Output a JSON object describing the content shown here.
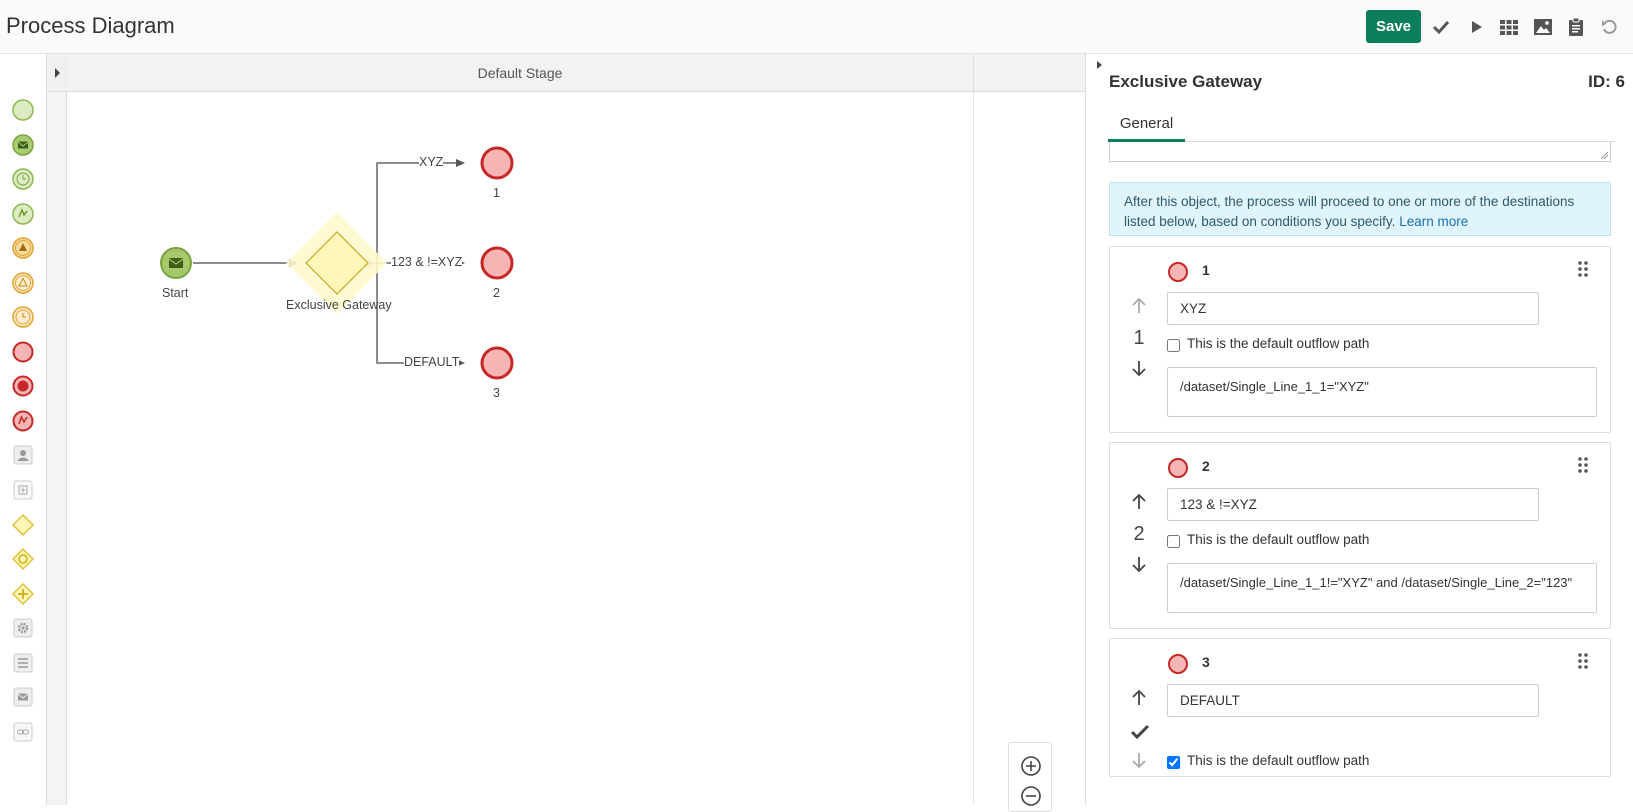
{
  "header": {
    "title": "Process Diagram",
    "save_label": "Save",
    "tools": [
      "check-icon",
      "play-icon",
      "grid-icon",
      "image-icon",
      "clipboard-icon",
      "undo-icon"
    ]
  },
  "palette": {
    "items": [
      "start-event-icon",
      "start-message-icon",
      "start-timer-icon",
      "start-signal-icon",
      "intermediate-escalation-icon",
      "intermediate-signal-icon",
      "intermediate-timer-icon",
      "end-event-icon",
      "end-terminate-icon",
      "end-error-icon",
      "user-task-icon",
      "subprocess-icon",
      "exclusive-gateway-icon",
      "inclusive-gateway-icon",
      "parallel-gateway-icon",
      "service-task-icon",
      "script-task-icon",
      "send-task-icon",
      "link-icon"
    ]
  },
  "canvas": {
    "stage_label": "Default Stage",
    "nodes": {
      "start": "Start",
      "gateway": "Exclusive Gateway",
      "end1": "1",
      "end2": "2",
      "end3": "3"
    },
    "edges": {
      "e1": "XYZ",
      "e2": "123 & !=XYZ",
      "e3": "DEFAULT"
    }
  },
  "panel": {
    "title": "Exclusive Gateway",
    "id_label": "ID: 6",
    "tab": "General",
    "info_text": "After this object, the process will proceed to one or more of the destinations listed below, based on conditions you specify.",
    "info_link": "Learn more",
    "default_label": "This is the default outflow path",
    "outflows": [
      {
        "target": "1",
        "order": "1",
        "label": "XYZ",
        "is_default": false,
        "condition": "/dataset/Single_Line_1_1=\"XYZ\""
      },
      {
        "target": "2",
        "order": "2",
        "label": "123 & !=XYZ",
        "is_default": false,
        "condition": "/dataset/Single_Line_1_1!=\"XYZ\" and /dataset/Single_Line_2=\"123\""
      },
      {
        "target": "3",
        "order": "",
        "label": "DEFAULT",
        "is_default": true,
        "condition": ""
      }
    ]
  },
  "colors": {
    "accent": "#0a7d5a",
    "end_event_fill": "#f5b5b5",
    "end_event_stroke": "#c62828",
    "start_fill": "#a5c96b",
    "gateway_fill": "#fff7b8"
  }
}
